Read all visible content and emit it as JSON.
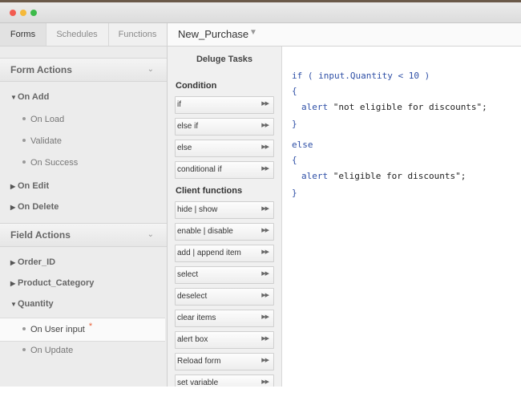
{
  "window": {
    "controls": [
      "close",
      "minimize",
      "zoom"
    ]
  },
  "tabs": [
    {
      "label": "Forms",
      "active": true
    },
    {
      "label": "Schedules",
      "active": false
    },
    {
      "label": "Functions",
      "active": false
    }
  ],
  "document": {
    "title": "New_Purchase"
  },
  "form_actions": {
    "label": "Form Actions",
    "on_add": "On Add",
    "on_load": "On Load",
    "validate": "Validate",
    "on_success": "On Success",
    "on_edit": "On Edit",
    "on_delete": "On Delete"
  },
  "field_actions": {
    "label": "Field Actions",
    "order_id": "Order_ID",
    "product_category": "Product_Category",
    "quantity": "Quantity",
    "on_user_input": "On User input",
    "required_mark": "*",
    "on_update": "On Update"
  },
  "tasks": {
    "title": "Deluge Tasks",
    "condition_label": "Condition",
    "condition": [
      "if",
      "else if",
      "else",
      "conditional if"
    ],
    "client_label": "Client functions",
    "client": [
      "hide | show",
      "enable | disable",
      "add | append item",
      "select",
      "deselect",
      "clear items",
      "alert box",
      "Reload form",
      "set variable"
    ]
  },
  "code": {
    "if_kw": "if",
    "if_cond": " ( input.Quantity < 10 )",
    "open1": "{",
    "alert1_kw": "alert",
    "alert1_str": " \"not eligible for discounts\";",
    "close1": "}",
    "else_kw": "else",
    "open2": "{",
    "alert2_kw": "alert",
    "alert2_str": " \"eligible for discounts\";",
    "close2": "}"
  }
}
